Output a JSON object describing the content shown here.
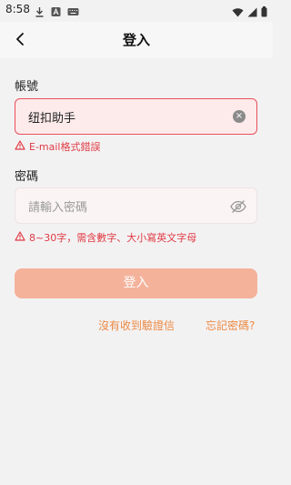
{
  "status_bar": {
    "time": "8:58",
    "icons_left": [
      "download-icon",
      "text-a-icon",
      "keyboard-icon"
    ],
    "icons_right": [
      "wifi-icon",
      "signal-icon",
      "battery-icon"
    ]
  },
  "nav": {
    "title": "登入"
  },
  "account": {
    "label": "帳號",
    "value": "纽扣助手",
    "error": "E-mail格式錯誤"
  },
  "password": {
    "label": "密碼",
    "placeholder": "請輸入密碼",
    "hint": "8~30字，需含數字、大小寫英文字母"
  },
  "login_button": "登入",
  "links": {
    "no_email": "沒有收到驗證信",
    "forgot": "忘記密碼?"
  },
  "colors": {
    "accent": "#ec8a44",
    "error": "#e03b44",
    "button": "#f4b29b"
  }
}
